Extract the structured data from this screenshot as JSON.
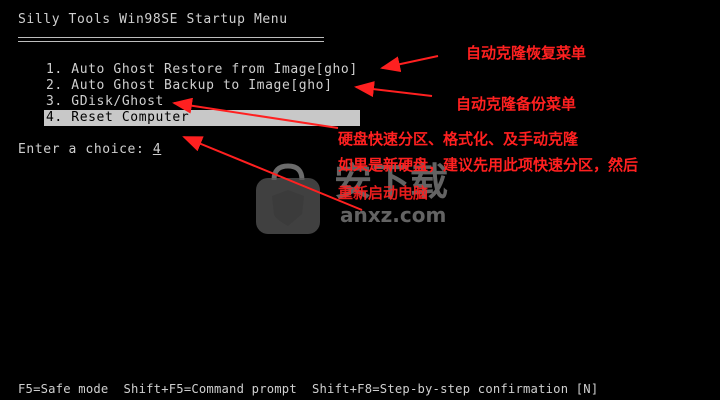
{
  "title": "Silly Tools Win98SE Startup Menu",
  "menu": {
    "items": [
      {
        "label": "1. Auto Ghost Restore from Image[gho]"
      },
      {
        "label": "2. Auto Ghost Backup to Image[gho]"
      },
      {
        "label": "3. GDisk/Ghost"
      },
      {
        "label": "4. Reset Computer"
      }
    ],
    "selected_index": 4
  },
  "prompt": {
    "label": "Enter a choice: ",
    "value": "4"
  },
  "footer": {
    "text": "F5=Safe mode  Shift+F5=Command prompt  Shift+F8=Step-by-step confirmation [N]"
  },
  "annotations": {
    "restore": "自动克隆恢复菜单",
    "backup": "自动克隆备份菜单",
    "gdisk_line1": "硬盘快速分区、格式化、及手动克隆",
    "gdisk_line2": "如果是新硬盘，建议先用此项快速分区，然后",
    "reset": "重新启动电脑",
    "color": "#ff2020"
  },
  "watermark": {
    "icon": "shield-bag-icon",
    "text_cn": "安下载",
    "text_en": "anxz.com"
  }
}
